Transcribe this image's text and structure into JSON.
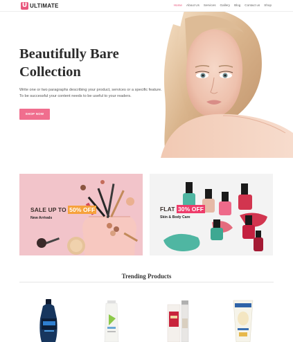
{
  "header": {
    "logo_mark": "U",
    "logo_text": "ULTIMATE",
    "nav": [
      {
        "label": "Home",
        "active": true
      },
      {
        "label": "About Us",
        "active": false
      },
      {
        "label": "Services",
        "active": false
      },
      {
        "label": "Gallery",
        "active": false
      },
      {
        "label": "Blog",
        "active": false
      },
      {
        "label": "Contact us",
        "active": false
      },
      {
        "label": "Shop",
        "active": false
      }
    ]
  },
  "hero": {
    "title_line1": "Beautifully Bare",
    "title_line2": "Collection",
    "description_line1": "Write one or two paragraphs describing your product, services or a specific feature.",
    "description_line2": "To be successful your content needs to be useful to your readers.",
    "button_label": "SHOP NOW"
  },
  "promos": [
    {
      "headline_prefix": "SALE UP TO ",
      "discount": "50% OFF",
      "subtitle": "New Arrivals"
    },
    {
      "headline_prefix": "FLAT ",
      "discount": "30% OFF",
      "subtitle": "Skin & Body Care"
    }
  ],
  "trending": {
    "title": "Trending Products"
  },
  "product_icons": [
    "body-wash-bottle-icon",
    "cream-tube-icon",
    "serum-box-icon",
    "lotion-tube-icon"
  ],
  "colors": {
    "accent": "#e8577d",
    "button": "#f06e8e",
    "promo_left_bg": "#f2c4ca",
    "promo_left_discount": "#f6a23c",
    "promo_right_discount": "#ee3b6a"
  }
}
